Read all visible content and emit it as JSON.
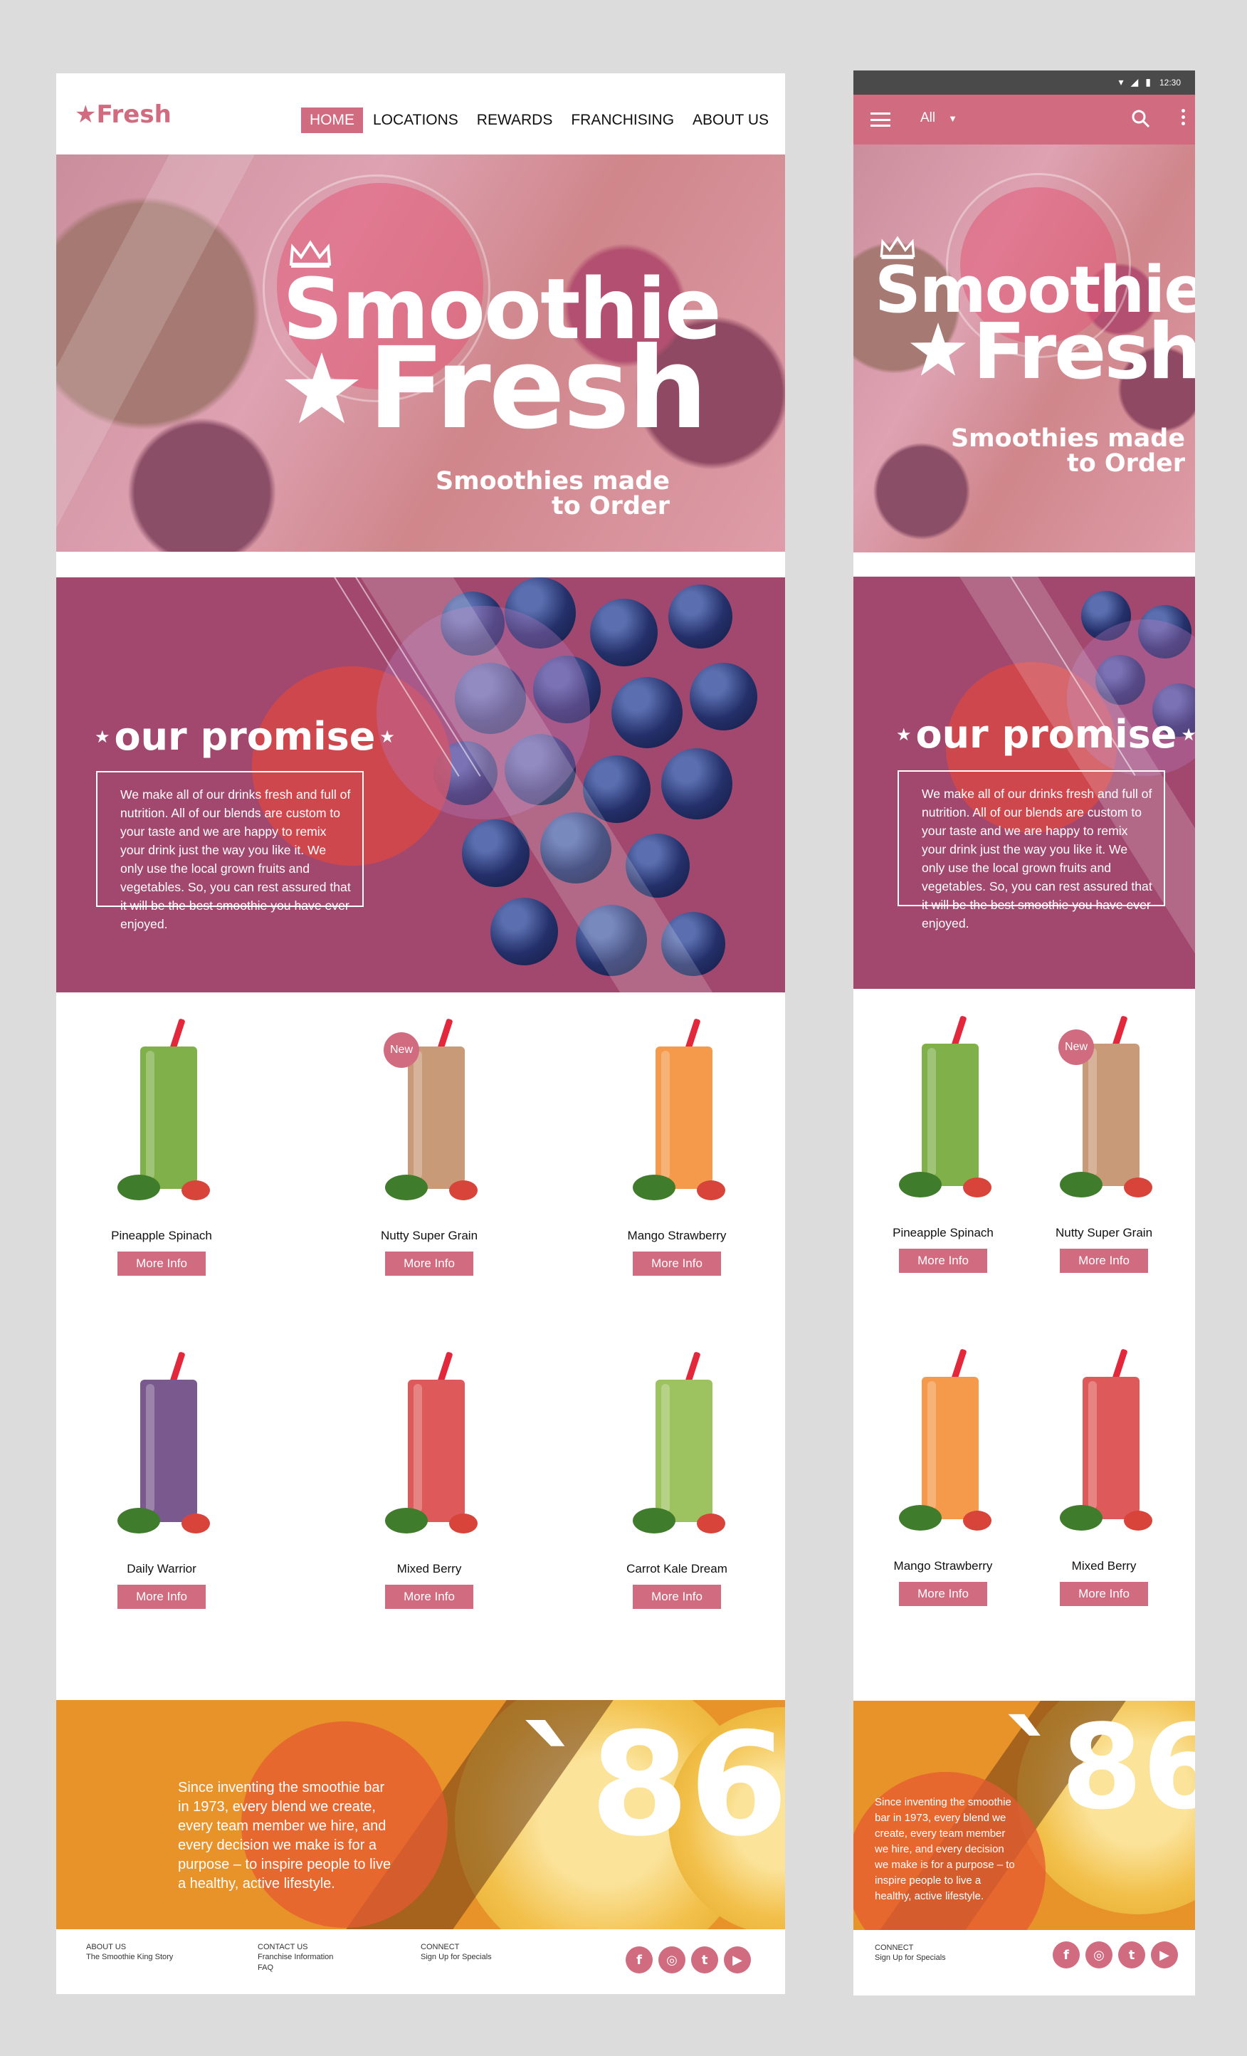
{
  "brand": {
    "logo_text": "★Fresh",
    "accent": "#d06b80"
  },
  "nav": {
    "items": [
      "HOME",
      "LOCATIONS",
      "REWARDS",
      "FRANCHISING",
      "ABOUT US"
    ],
    "active": "HOME"
  },
  "hero": {
    "line1": "Smoothie",
    "line2": "Fresh",
    "tag_line1": "Smoothies made",
    "tag_line2": "to Order"
  },
  "promise": {
    "title": "our promise",
    "body": "We make all of our drinks fresh and full of nutrition. All of our blends are custom to your taste and we are happy to remix your drink just the way you like it. We only use the local grown fruits and vegetables. So, you can rest assured that it will be the best smoothie you have ever enjoyed."
  },
  "products_desktop": [
    {
      "name": "Pineapple Spinach",
      "color": "#7fb04a",
      "badge": "",
      "button": "More Info"
    },
    {
      "name": "Nutty Super Grain",
      "color": "#c99a78",
      "badge": "New",
      "button": "More Info"
    },
    {
      "name": "Mango Strawberry",
      "color": "#f59a4a",
      "badge": "",
      "button": "More Info"
    },
    {
      "name": "Daily Warrior",
      "color": "#7a5a8e",
      "badge": "",
      "button": "More Info"
    },
    {
      "name": "Mixed Berry",
      "color": "#de5a5a",
      "badge": "",
      "button": "More Info"
    },
    {
      "name": "Carrot Kale Dream",
      "color": "#9cc360",
      "badge": "",
      "button": "More Info"
    }
  ],
  "products_mobile": [
    {
      "name": "Pineapple Spinach",
      "color": "#7fb04a",
      "badge": "",
      "button": "More Info"
    },
    {
      "name": "Nutty Super Grain",
      "color": "#c99a78",
      "badge": "New",
      "button": "More Info"
    },
    {
      "name": "Mango Strawberry",
      "color": "#f59a4a",
      "badge": "",
      "button": "More Info"
    },
    {
      "name": "Mixed Berry",
      "color": "#de5a5a",
      "badge": "",
      "button": "More Info"
    }
  ],
  "story": {
    "year": "`86",
    "text": "Since inventing the smoothie bar in 1973, every blend we create, every team member we hire, and every decision we make is for a purpose – to inspire people to live a healthy, active lifestyle."
  },
  "footer": {
    "about_title": "ABOUT US",
    "about_link": "The Smoothie King Story",
    "contact_title": "CONTACT US",
    "contact_link1": "Franchise Information",
    "contact_link2": "FAQ",
    "connect_title": "CONNECT",
    "connect_link": "Sign Up for Specials",
    "social": [
      "facebook-icon",
      "instagram-icon",
      "twitter-icon",
      "youtube-icon"
    ]
  },
  "mobile": {
    "status_time": "12:30",
    "select_label": "All"
  }
}
